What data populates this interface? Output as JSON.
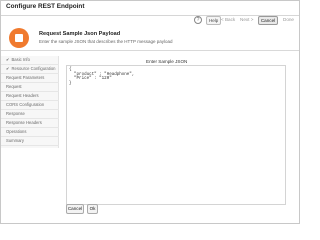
{
  "window": {
    "title": "Configure REST Endpoint"
  },
  "toolbar": {
    "help_label": "Help",
    "back_label": "< Back",
    "next_label": "Next >",
    "cancel_label": "Cancel",
    "done_label": "Done"
  },
  "header": {
    "title": "Request Sample Json Payload",
    "description": "Enter the sample JSON that describes the HTTP message payload"
  },
  "sidebar": {
    "items": [
      {
        "label": "Basic Info",
        "checked": true
      },
      {
        "label": "Resource Configuration",
        "checked": true
      },
      {
        "label": "Request Parameters",
        "checked": false
      },
      {
        "label": "Request",
        "checked": false
      },
      {
        "label": "Request Headers",
        "checked": false
      },
      {
        "label": "CORS Configuration",
        "checked": false
      },
      {
        "label": "Response",
        "checked": false
      },
      {
        "label": "Response Headers",
        "checked": false
      },
      {
        "label": "Operations",
        "checked": false
      },
      {
        "label": "Summary",
        "checked": false
      }
    ]
  },
  "main": {
    "title": "Enter Sample JSON",
    "editor_text": "{\n  \"product\" : \"Headphone\",\n  \"Price\" : \"120\"\n}"
  },
  "footer": {
    "cancel_label": "Cancel",
    "ok_label": "Ok"
  },
  "colors": {
    "accent": "#f07a2e"
  }
}
